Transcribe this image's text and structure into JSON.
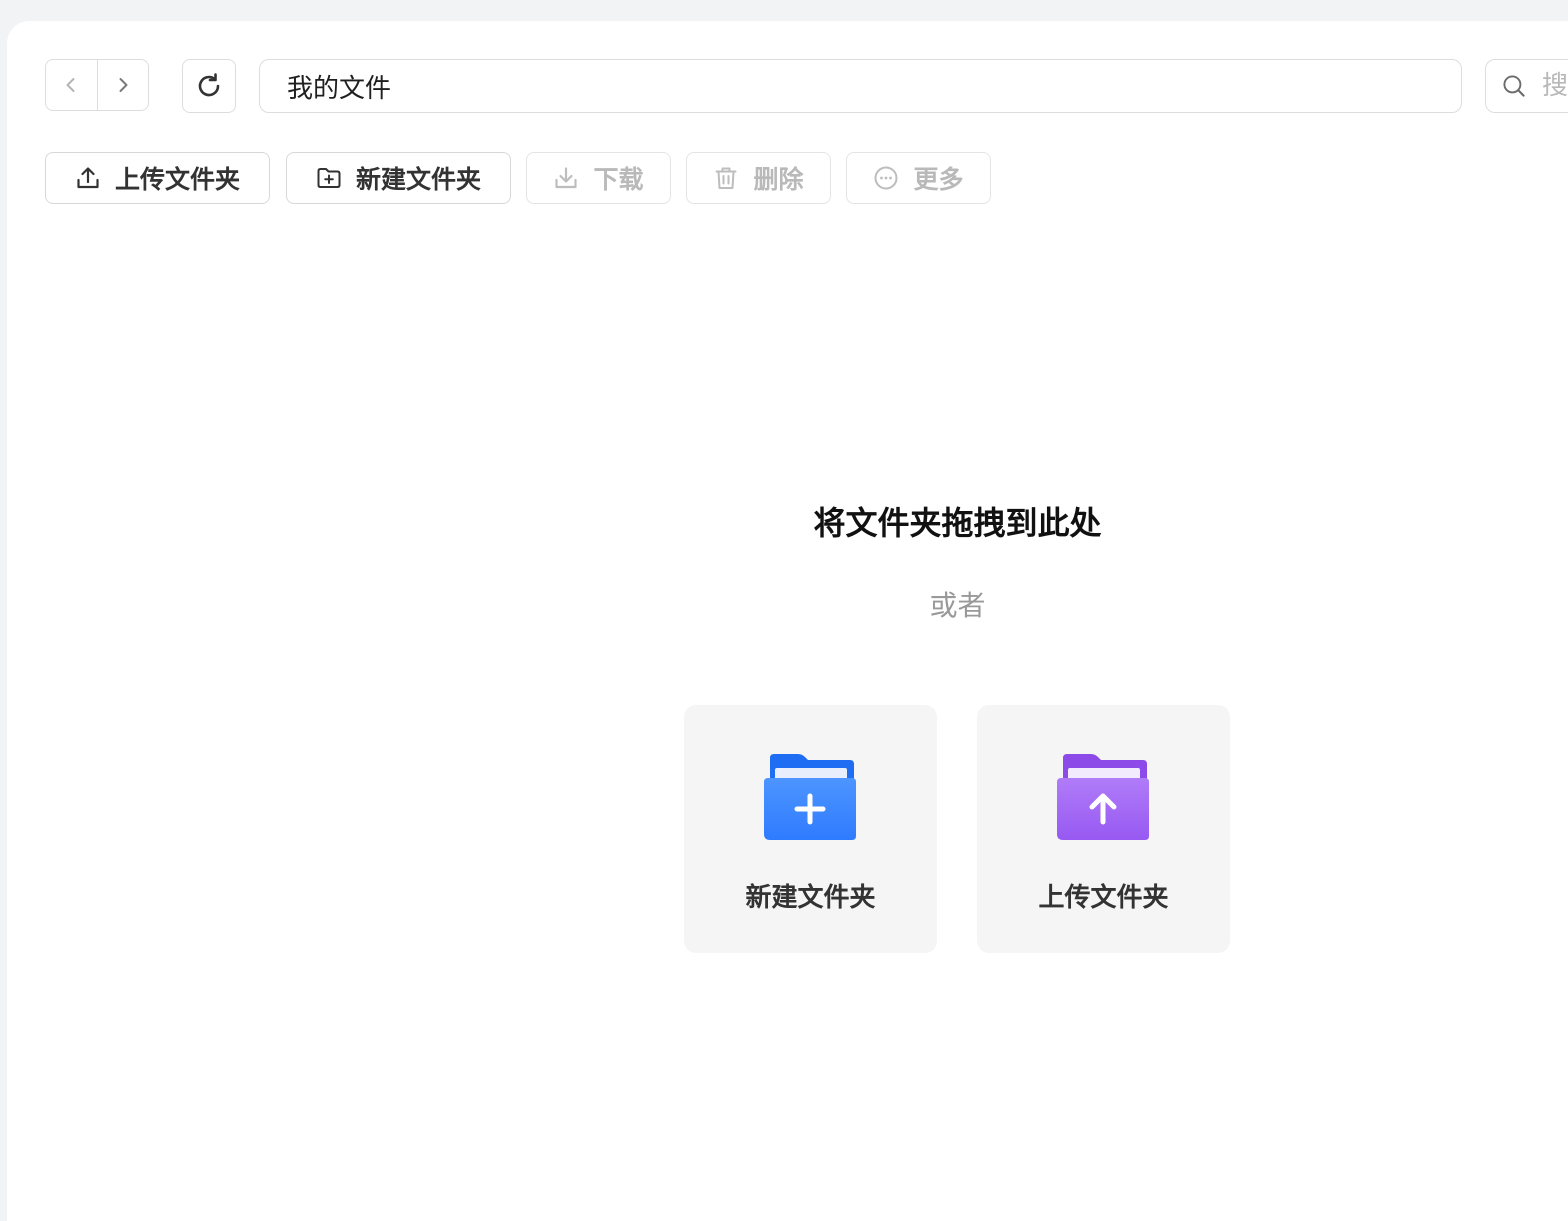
{
  "nav": {
    "back_icon": "chevron-left",
    "forward_icon": "chevron-right",
    "refresh_icon": "refresh"
  },
  "path": {
    "current": "我的文件"
  },
  "search": {
    "placeholder": "搜",
    "icon": "search"
  },
  "toolbar": {
    "upload_folder": "上传文件夹",
    "new_folder": "新建文件夹",
    "download": "下载",
    "delete": "删除",
    "more": "更多"
  },
  "empty_state": {
    "title": "将文件夹拖拽到此处",
    "or": "或者",
    "new_folder_card": "新建文件夹",
    "upload_folder_card": "上传文件夹"
  },
  "colors": {
    "new_folder_icon": "#2f7bff",
    "upload_folder_icon": "#9b5cf6",
    "disabled_text": "#b9b9b9"
  }
}
